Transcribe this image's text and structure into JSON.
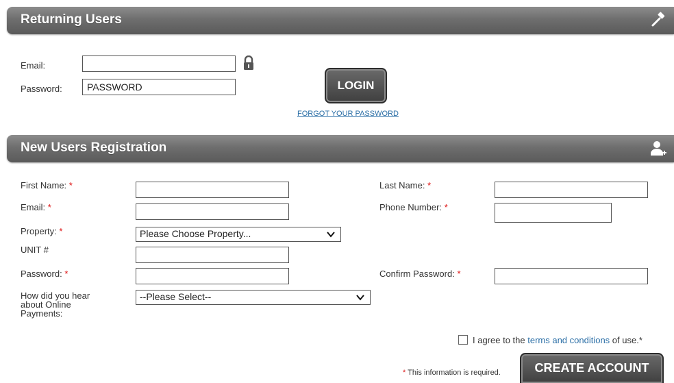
{
  "returning": {
    "title": "Returning Users",
    "icon": "hammer-icon",
    "email_label": "Email:",
    "email_value": "",
    "password_label": "Password:",
    "password_value": "PASSWORD",
    "login_label": "LOGIN",
    "forgot_label": "FORGOT YOUR PASSWORD"
  },
  "registration": {
    "title": "New Users Registration",
    "icon": "add-user-icon",
    "required_mark": "*",
    "first_name_label": "First Name:",
    "last_name_label": "Last Name:",
    "email_label": "Email:",
    "phone_label": "Phone Number:",
    "property_label": "Property:",
    "property_selected": "Please Choose Property...",
    "unit_label": "UNIT #",
    "password_label": "Password:",
    "confirm_password_label": "Confirm Password:",
    "heard_label": "How did you hear about Online Payments:",
    "heard_selected": "--Please Select--",
    "agree_prefix": "I agree to the ",
    "agree_link": "terms and conditions",
    "agree_suffix": " of use.*",
    "required_note_mark": "*",
    "required_note": " This information is required.",
    "create_label": "CREATE ACCOUNT"
  },
  "colors": {
    "bar": "#6e6e6e",
    "required": "#dd1111",
    "link": "#2a6ea6"
  }
}
